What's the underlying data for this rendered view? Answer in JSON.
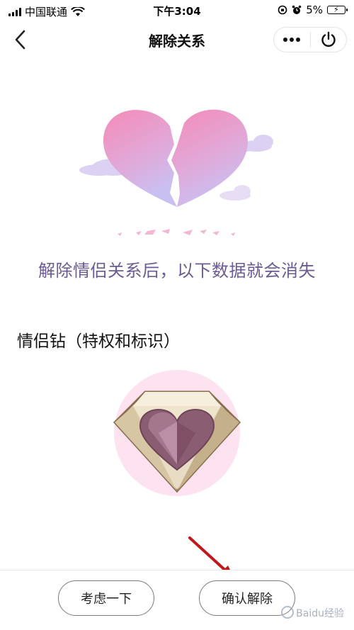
{
  "status_bar": {
    "carrier": "中国联通",
    "time": "下午3:04",
    "battery_percent": "5%"
  },
  "nav": {
    "title": "解除关系",
    "back_icon": "chevron-left-icon",
    "more_icon": "more-icon",
    "power_icon": "power-icon"
  },
  "main": {
    "message": "解除情侣关系后，以下数据就会消失",
    "section_label": "情侣钻（特权和标识）"
  },
  "actions": {
    "consider_label": "考虑一下",
    "confirm_label": "确认解除"
  },
  "watermark": {
    "text": "Baidu经验"
  },
  "colors": {
    "message_purple": "#6b5a93",
    "heart_pink": "#f48fb9",
    "heart_lilac": "#c9b8ef",
    "diamond_circle": "#fde3ef",
    "arrow_red": "#c0171c"
  }
}
